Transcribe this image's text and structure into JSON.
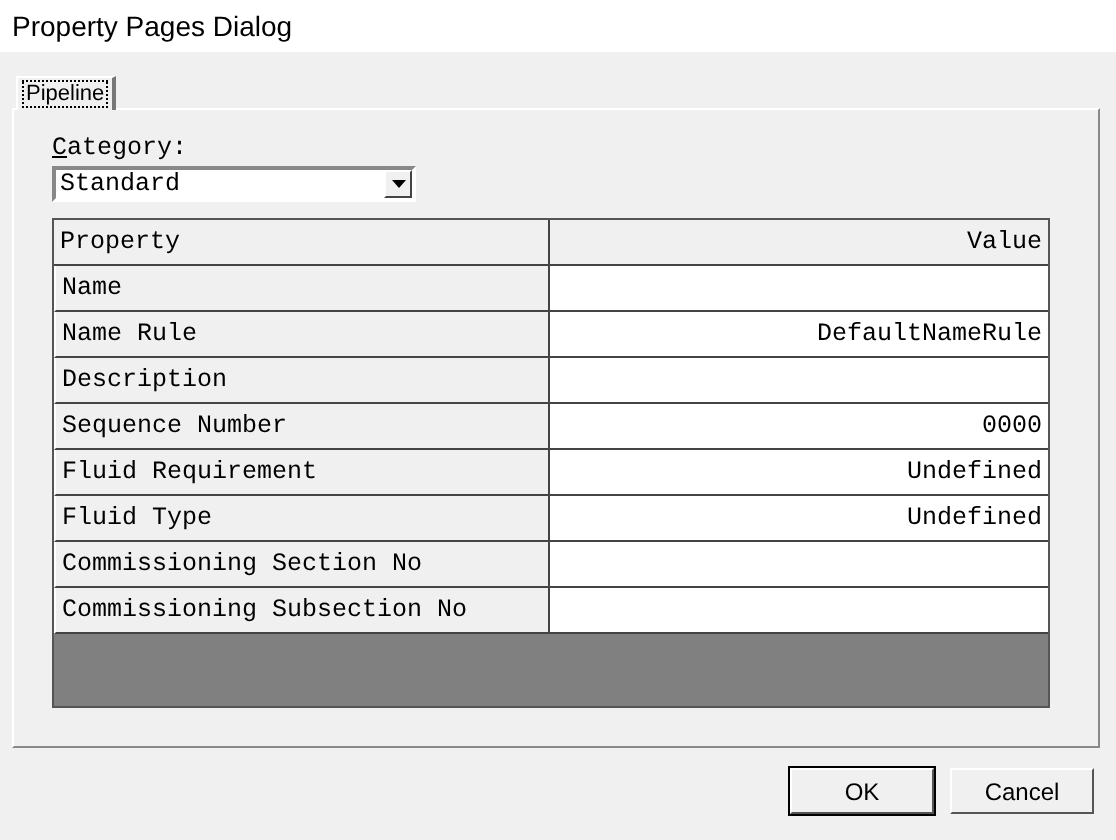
{
  "window": {
    "title": "Property Pages Dialog"
  },
  "tabs": [
    {
      "label": "Pipeline",
      "selected": true
    }
  ],
  "category": {
    "label": "Category:",
    "value": "Standard"
  },
  "grid": {
    "columns": [
      "Property",
      "Value"
    ],
    "rows": [
      {
        "property": "Name",
        "value": ""
      },
      {
        "property": "Name Rule",
        "value": "DefaultNameRule"
      },
      {
        "property": "Description",
        "value": ""
      },
      {
        "property": "Sequence Number",
        "value": "0000"
      },
      {
        "property": "Fluid Requirement",
        "value": "Undefined"
      },
      {
        "property": "Fluid Type",
        "value": "Undefined"
      },
      {
        "property": "Commissioning Section No",
        "value": ""
      },
      {
        "property": "Commissioning Subsection No",
        "value": ""
      }
    ]
  },
  "buttons": [
    {
      "label": "OK",
      "default": true
    },
    {
      "label": "Cancel",
      "default": false
    }
  ]
}
